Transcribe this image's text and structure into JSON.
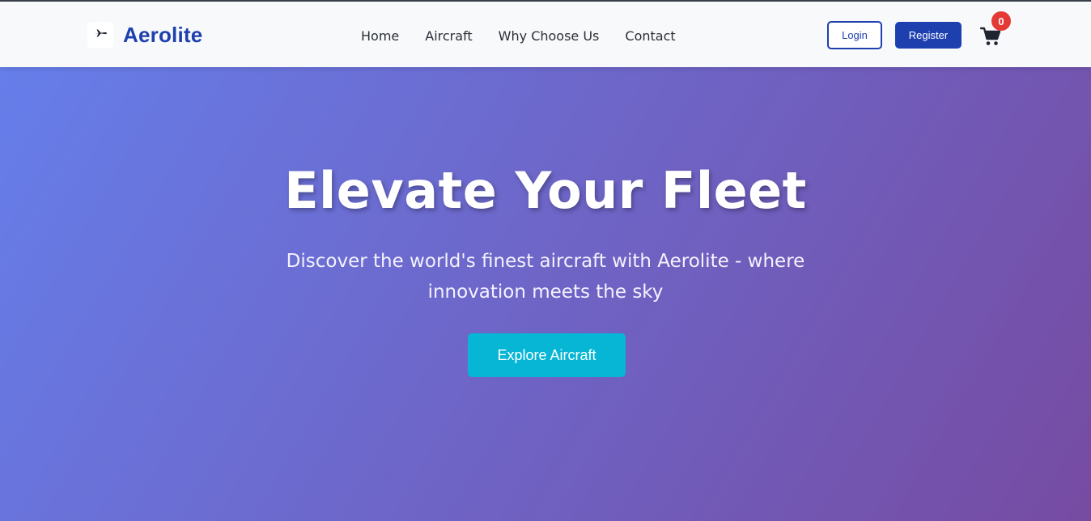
{
  "brand": {
    "name": "Aerolite",
    "logo_icon": "airplane-icon"
  },
  "nav": {
    "items": [
      "Home",
      "Aircraft",
      "Why Choose Us",
      "Contact"
    ]
  },
  "auth": {
    "login_label": "Login",
    "register_label": "Register"
  },
  "cart": {
    "icon": "shopping-cart-icon",
    "count": "0"
  },
  "hero": {
    "title": "Elevate Your Fleet",
    "subtitle": "Discover the world's finest aircraft with Aerolite - where innovation meets the sky",
    "cta_label": "Explore Aircraft"
  },
  "colors": {
    "brand": "#1e40af",
    "accent": "#06b6d4",
    "badge": "#e53935",
    "hero_gradient_start": "#667eea",
    "hero_gradient_end": "#764ba2"
  }
}
